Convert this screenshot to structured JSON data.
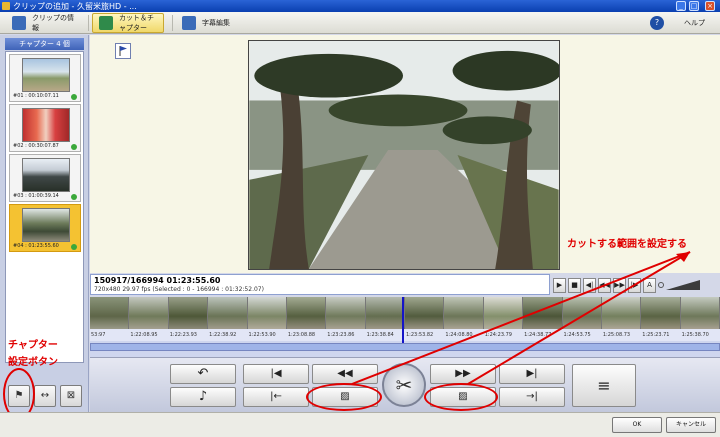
{
  "window": {
    "title": "クリップの追加 - 久留米旅HD - ...",
    "minimize_glyph": "_",
    "maximize_glyph": "□",
    "close_glyph": "×"
  },
  "tabs": [
    {
      "label": "クリップの情報",
      "icon": "clip-info-icon"
    },
    {
      "label": "カット＆チャプター",
      "icon": "cut-chapter-icon"
    },
    {
      "label": "字幕編集",
      "icon": "subtitle-edit-icon"
    }
  ],
  "help": {
    "label": "ヘルプ",
    "glyph": "?"
  },
  "chapters": {
    "header": "チャプター 4 個",
    "items": [
      {
        "label": "#01 : 00:10:07.11"
      },
      {
        "label": "#02 : 00:30:07.87"
      },
      {
        "label": "#03 : 01:00:39.14"
      },
      {
        "label": "#04 : 01:23:55.60"
      }
    ],
    "selected_index": 3
  },
  "annotations": {
    "left_line1": "チャプター",
    "left_line2": "設定ボタン",
    "right": "カットする範囲を設定する"
  },
  "info": {
    "line1": "150917/166994 01:23:55.60",
    "line2": "720x480 29.97 fps (Selected : 0 - 166994 : 01:32:52.07)"
  },
  "transport": [
    "▶",
    "■",
    "◀|",
    "◀◀",
    "▶▶",
    "|▶",
    "A"
  ],
  "timeline": {
    "timecodes": [
      "53:97",
      "1:22:08.95",
      "1:22:23.93",
      "1:22:38.92",
      "1:22:53.90",
      "1:23:08.88",
      "1:23:23.86",
      "1:23:38.84",
      "1:23:53.82",
      "1:24:08.80",
      "1:24:23.79",
      "1:24:38.77",
      "1:24:53.75",
      "1:25:08.73",
      "1:25:23.71",
      "1:25:38.70"
    ]
  },
  "edit_buttons": {
    "undo_glyph": "↶",
    "music_glyph": "♪",
    "set_start_glyph": "|◀",
    "prev_glyph": "◀◀",
    "next_glyph": "▶▶",
    "set_end_glyph": "▶|",
    "start_range_glyph": "▨",
    "end_range_glyph": "▨",
    "go_start_glyph": "|←",
    "go_end_glyph": "→|",
    "scissors_glyph": "✂",
    "list_glyph": "≡"
  },
  "left_buttons": {
    "flag_glyph": "⚑",
    "split_glyph": "↔",
    "delete_glyph": "⊠"
  },
  "dialog": {
    "ok": "OK",
    "cancel": "キャンセル"
  }
}
